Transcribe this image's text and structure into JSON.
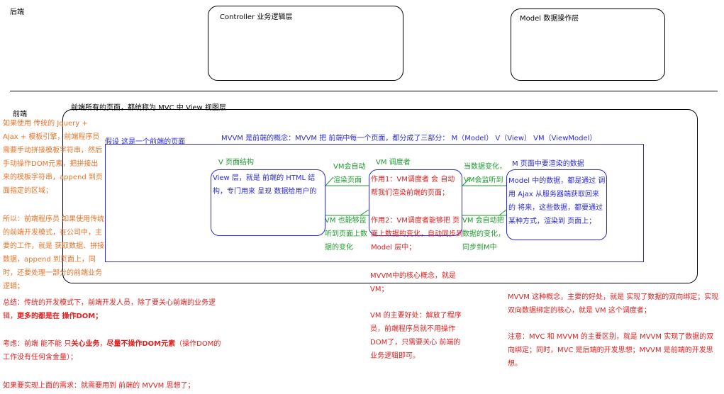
{
  "backend": {
    "label": "后端",
    "controller_box": "Controller 业务逻辑层",
    "model_box": "Model 数据操作层"
  },
  "frontend": {
    "label": "前端",
    "outer_title": "前端所有的页面，都统称为 MVC 中 View 视图层",
    "page_assumption": "假设 这是一个前端的页面",
    "mvvm_concept": "MVVM 是前端的概念：MVVM 把 前端中每一个页面，都分成了三部分： M（Model） V（View） VM（ViewModel）"
  },
  "view": {
    "title": "V 页面结构",
    "body": "View 层，就是 前端的 HTML 结构，专门用来 呈现 数据给用户的"
  },
  "vm": {
    "title": "VM 调度者",
    "body1": "作用1：VM调度者 会 自动帮我们渲染前端的页面；",
    "body2": "作用2：VM调度者能够把 页面上数据的变化，自动同步到 Model 层中；"
  },
  "model": {
    "title": "M 页面中要渲染的数据",
    "body": "Model 中的数据，都是通过 调用 Ajax 从服务器端获取回来的 将来，这些数据，都要通过某种方式，渲染到 页面上；"
  },
  "arrows": {
    "vm_render": "VM会自动渲染页面",
    "vm_listen": "VM 也能够监听到页面上数据的变化",
    "data_change": "当数据变化，VM会监听到",
    "vm_sync": "VM 会自动把数据的变化，同步到M中"
  },
  "left_notes": {
    "para1": "如果使用 传统的 Jquery + Ajax + 模板引擎，前端程序员需要手动拼接模板字符串，然后手动操作DOM元素，把拼接出来的模板字符串，append 到页面指定的区域；",
    "para2": "所以：前端程序员 如果使用传统的前端开发模式，在公司中，主要的工作，就是 获取数据、拼接数据，append 到页面上，同时，还要处理一部分的前端业务逻辑；"
  },
  "summary": {
    "line1": "总结：传统的开发模式下，前端开发人员，除了要关心前端的业务逻辑，",
    "line2_bold": "更多的都是在 操作DOM；",
    "line3_prefix": "考虑：前端 能不能 只",
    "line3_bold1": "关心业务",
    "line3_mid": "，",
    "line3_bold2": "尽量不操作DOM元素",
    "line3_suffix": "（操作DOM的工作没有任何含金量）；",
    "line4": "如果要实现上面的需求：就需要用到 前端的 MVVM 思想了；"
  },
  "core": {
    "concept": "MVVM中的核心概念，就是 VM；",
    "benefit": "VM 的主要好处：解放了程序员，前端程序员就不用操作DOM了，只需要关心 前端的业务逻辑即可。"
  },
  "right_notes": {
    "para1": "MVVM 这种概念，主要的好处，就是 实现了数据的双向绑定；实现双向数据绑定的核心，就是 VM 这个调度者；",
    "para2": "注意：MVC 和 MVVM 的主要区别，就是 MVVM 实现了数据的双向绑定；同时，MVC 是后端的开发思想；MVVM 是前端的开发思想。"
  }
}
